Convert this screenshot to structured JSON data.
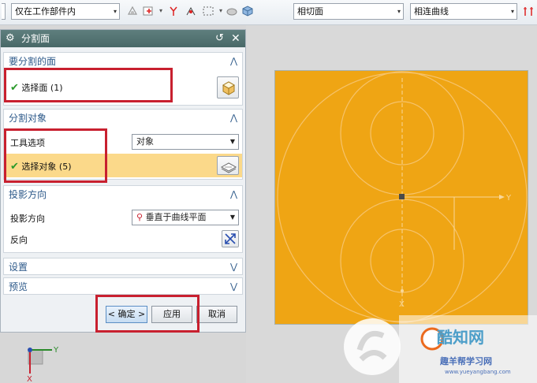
{
  "toolbar": {
    "dropdown_left_value": "",
    "dropdown_scope": "仅在工作部件内",
    "dropdown_face": "相切面",
    "dropdown_curve": "相连曲线",
    "arrow_glyph": "▾",
    "icons": [
      "sparkle-icon",
      "add-box-icon",
      "snap-icon",
      "select-box-icon",
      "solid-icon",
      "cube-icon",
      "separator-icon"
    ]
  },
  "dialog": {
    "title": "分割面",
    "section_faces": {
      "title": "要分割的面",
      "select_label": "选择面 (1)"
    },
    "section_objects": {
      "title": "分割对象",
      "tool_option_label": "工具选项",
      "tool_option_value": "对象",
      "select_label": "选择对象 (5)"
    },
    "section_projection": {
      "title": "投影方向",
      "projection_label": "投影方向",
      "projection_value": "垂直于曲线平面",
      "reverse_label": "反向"
    },
    "section_settings": {
      "title": "设置"
    },
    "section_preview": {
      "title": "预览"
    },
    "buttons": {
      "ok": "< 确定 >",
      "apply": "应用",
      "cancel": "取消"
    }
  },
  "viewport": {
    "triad_small": {
      "x": "X",
      "y": "Y"
    },
    "triad_face": {
      "x": "X",
      "y": "Y"
    },
    "face_color": "#efa514",
    "highlight_color": "#c8202f"
  },
  "watermark": {
    "brand": "酷知网",
    "sub": "趣羊帮学习网",
    "url": "www.yueyangbang.com"
  }
}
